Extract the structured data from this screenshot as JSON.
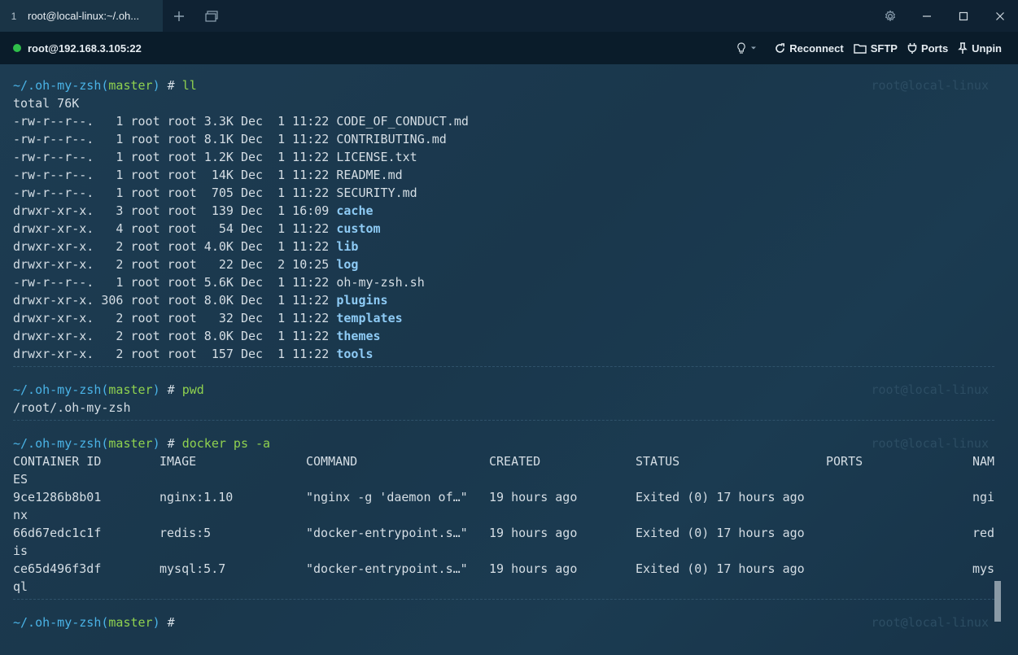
{
  "tab": {
    "index": "1",
    "title": "root@local-linux:~/.oh..."
  },
  "host": {
    "address": "root@192.168.3.105:22",
    "reconnect": "Reconnect",
    "sftp": "SFTP",
    "ports": "Ports",
    "unpin": "Unpin"
  },
  "prompt": {
    "path": "~/.oh-my-zsh",
    "branch": "master",
    "hash": "#",
    "host_ghost": "root@local-linux"
  },
  "commands": {
    "ll": "ll",
    "pwd": "pwd",
    "docker": "docker ps -a"
  },
  "ll_output": {
    "total": "total 76K",
    "rows": [
      {
        "perm": "-rw-r--r--.",
        "links": "1",
        "user": "root",
        "group": "root",
        "size": "3.3K",
        "month": "Dec",
        "day": "1",
        "time": "11:22",
        "name": "CODE_OF_CONDUCT.md",
        "dir": false
      },
      {
        "perm": "-rw-r--r--.",
        "links": "1",
        "user": "root",
        "group": "root",
        "size": "8.1K",
        "month": "Dec",
        "day": "1",
        "time": "11:22",
        "name": "CONTRIBUTING.md",
        "dir": false
      },
      {
        "perm": "-rw-r--r--.",
        "links": "1",
        "user": "root",
        "group": "root",
        "size": "1.2K",
        "month": "Dec",
        "day": "1",
        "time": "11:22",
        "name": "LICENSE.txt",
        "dir": false
      },
      {
        "perm": "-rw-r--r--.",
        "links": "1",
        "user": "root",
        "group": "root",
        "size": "14K",
        "month": "Dec",
        "day": "1",
        "time": "11:22",
        "name": "README.md",
        "dir": false
      },
      {
        "perm": "-rw-r--r--.",
        "links": "1",
        "user": "root",
        "group": "root",
        "size": "705",
        "month": "Dec",
        "day": "1",
        "time": "11:22",
        "name": "SECURITY.md",
        "dir": false
      },
      {
        "perm": "drwxr-xr-x.",
        "links": "3",
        "user": "root",
        "group": "root",
        "size": "139",
        "month": "Dec",
        "day": "1",
        "time": "16:09",
        "name": "cache",
        "dir": true
      },
      {
        "perm": "drwxr-xr-x.",
        "links": "4",
        "user": "root",
        "group": "root",
        "size": "54",
        "month": "Dec",
        "day": "1",
        "time": "11:22",
        "name": "custom",
        "dir": true
      },
      {
        "perm": "drwxr-xr-x.",
        "links": "2",
        "user": "root",
        "group": "root",
        "size": "4.0K",
        "month": "Dec",
        "day": "1",
        "time": "11:22",
        "name": "lib",
        "dir": true
      },
      {
        "perm": "drwxr-xr-x.",
        "links": "2",
        "user": "root",
        "group": "root",
        "size": "22",
        "month": "Dec",
        "day": "2",
        "time": "10:25",
        "name": "log",
        "dir": true
      },
      {
        "perm": "-rw-r--r--.",
        "links": "1",
        "user": "root",
        "group": "root",
        "size": "5.6K",
        "month": "Dec",
        "day": "1",
        "time": "11:22",
        "name": "oh-my-zsh.sh",
        "dir": false
      },
      {
        "perm": "drwxr-xr-x.",
        "links": "306",
        "user": "root",
        "group": "root",
        "size": "8.0K",
        "month": "Dec",
        "day": "1",
        "time": "11:22",
        "name": "plugins",
        "dir": true
      },
      {
        "perm": "drwxr-xr-x.",
        "links": "2",
        "user": "root",
        "group": "root",
        "size": "32",
        "month": "Dec",
        "day": "1",
        "time": "11:22",
        "name": "templates",
        "dir": true
      },
      {
        "perm": "drwxr-xr-x.",
        "links": "2",
        "user": "root",
        "group": "root",
        "size": "8.0K",
        "month": "Dec",
        "day": "1",
        "time": "11:22",
        "name": "themes",
        "dir": true
      },
      {
        "perm": "drwxr-xr-x.",
        "links": "2",
        "user": "root",
        "group": "root",
        "size": "157",
        "month": "Dec",
        "day": "1",
        "time": "11:22",
        "name": "tools",
        "dir": true
      }
    ]
  },
  "pwd_output": "/root/.oh-my-zsh",
  "docker": {
    "headers": [
      "CONTAINER ID",
      "IMAGE",
      "COMMAND",
      "CREATED",
      "STATUS",
      "PORTS",
      "NAM"
    ],
    "header_wrap": "ES",
    "rows": [
      {
        "id": "9ce1286b8b01",
        "image": "nginx:1.10",
        "command": "\"nginx -g 'daemon of…\"",
        "created": "19 hours ago",
        "status": "Exited (0) 17 hours ago",
        "ports": "",
        "name": "ngi",
        "name_wrap": "nx"
      },
      {
        "id": "66d67edc1c1f",
        "image": "redis:5",
        "command": "\"docker-entrypoint.s…\"",
        "created": "19 hours ago",
        "status": "Exited (0) 17 hours ago",
        "ports": "",
        "name": "red",
        "name_wrap": "is"
      },
      {
        "id": "ce65d496f3df",
        "image": "mysql:5.7",
        "command": "\"docker-entrypoint.s…\"",
        "created": "19 hours ago",
        "status": "Exited (0) 17 hours ago",
        "ports": "",
        "name": "mys",
        "name_wrap": "ql"
      }
    ]
  }
}
